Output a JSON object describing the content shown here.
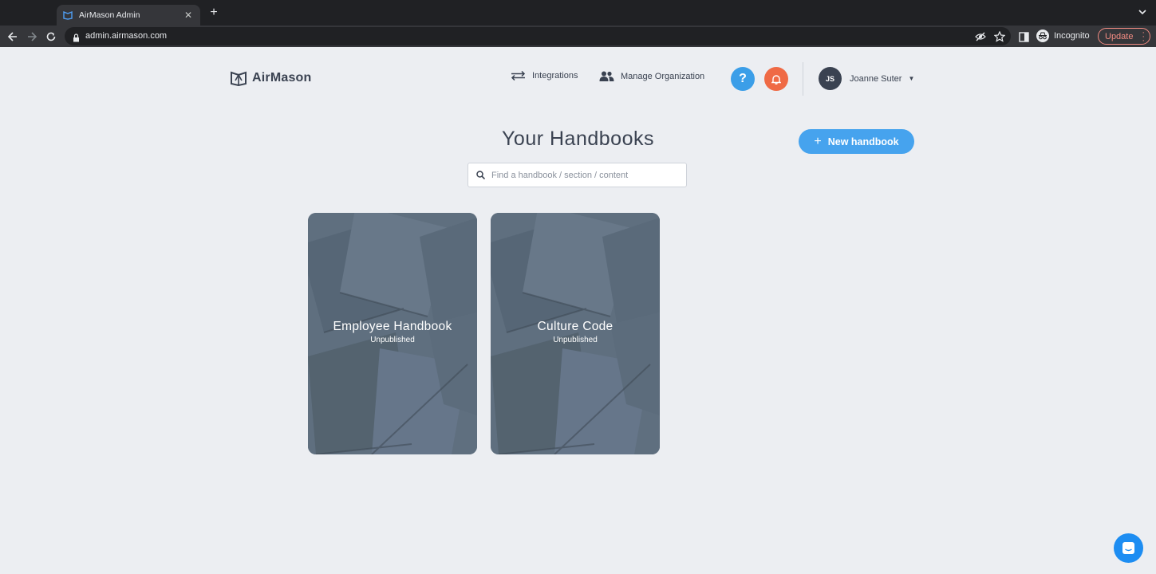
{
  "browser": {
    "tab_title": "AirMason Admin",
    "url": "admin.airmason.com",
    "incognito_label": "Incognito",
    "update_label": "Update"
  },
  "header": {
    "logo_text": "AirMason",
    "integrations_label": "Integrations",
    "manage_org_label": "Manage Organization",
    "help_label": "?",
    "user_initials": "JS",
    "user_name": "Joanne Suter"
  },
  "main": {
    "title": "Your Handbooks",
    "new_button_label": "New handbook",
    "search_placeholder": "Find a handbook / section / content"
  },
  "handbooks": [
    {
      "title": "Employee Handbook",
      "status": "Unpublished"
    },
    {
      "title": "Culture Code",
      "status": "Unpublished"
    }
  ],
  "colors": {
    "accent": "#46a3ee",
    "notification": "#ef6a45",
    "text": "#3a4251",
    "card": "#5e6e7e"
  }
}
